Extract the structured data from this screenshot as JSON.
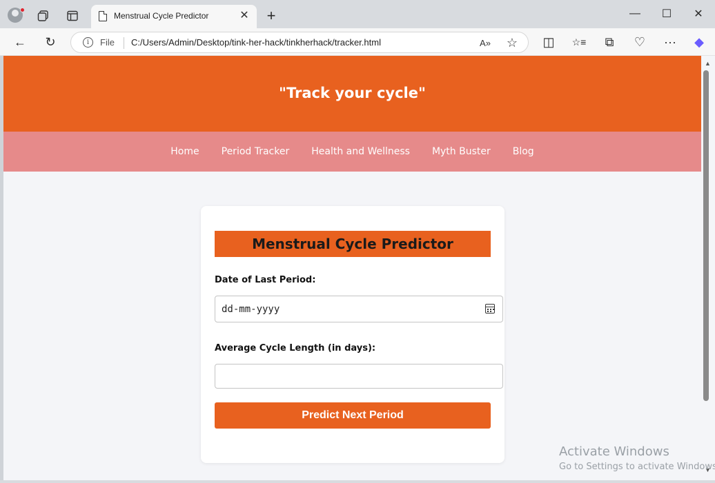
{
  "browser": {
    "tab_title": "Menstrual Cycle Predictor",
    "tab_close": "✕",
    "new_tab": "+",
    "window_minimize": "—",
    "window_maximize": "☐",
    "window_close": "✕",
    "address": {
      "scheme_label": "File",
      "url": "C:/Users/Admin/Desktop/tink-her-hack/tinkherhack/tracker.html"
    },
    "icons": {
      "back": "←",
      "refresh": "↻",
      "read_aloud": "A»",
      "favorite": "☆",
      "split": "◫",
      "favorites": "☆≡",
      "collections": "⧉",
      "health": "♡",
      "more": "···",
      "copilot": "◆"
    }
  },
  "header": {
    "title": "\"Track your cycle\""
  },
  "nav": {
    "items": [
      "Home",
      "Period Tracker",
      "Health and Wellness",
      "Myth Buster",
      "Blog"
    ]
  },
  "form": {
    "title": "Menstrual Cycle Predictor",
    "date_label": "Date of Last Period:",
    "date_placeholder": "dd-mm-yyyy",
    "cycle_label": "Average Cycle Length (in days):",
    "cycle_value": "",
    "submit_label": "Predict Next Period"
  },
  "watermark": {
    "title": "Activate Windows",
    "subtitle": "Go to Settings to activate Windows."
  },
  "colors": {
    "accent": "#e8611f",
    "nav_bg": "#e68a8a",
    "page_bg": "#f4f5f8"
  }
}
